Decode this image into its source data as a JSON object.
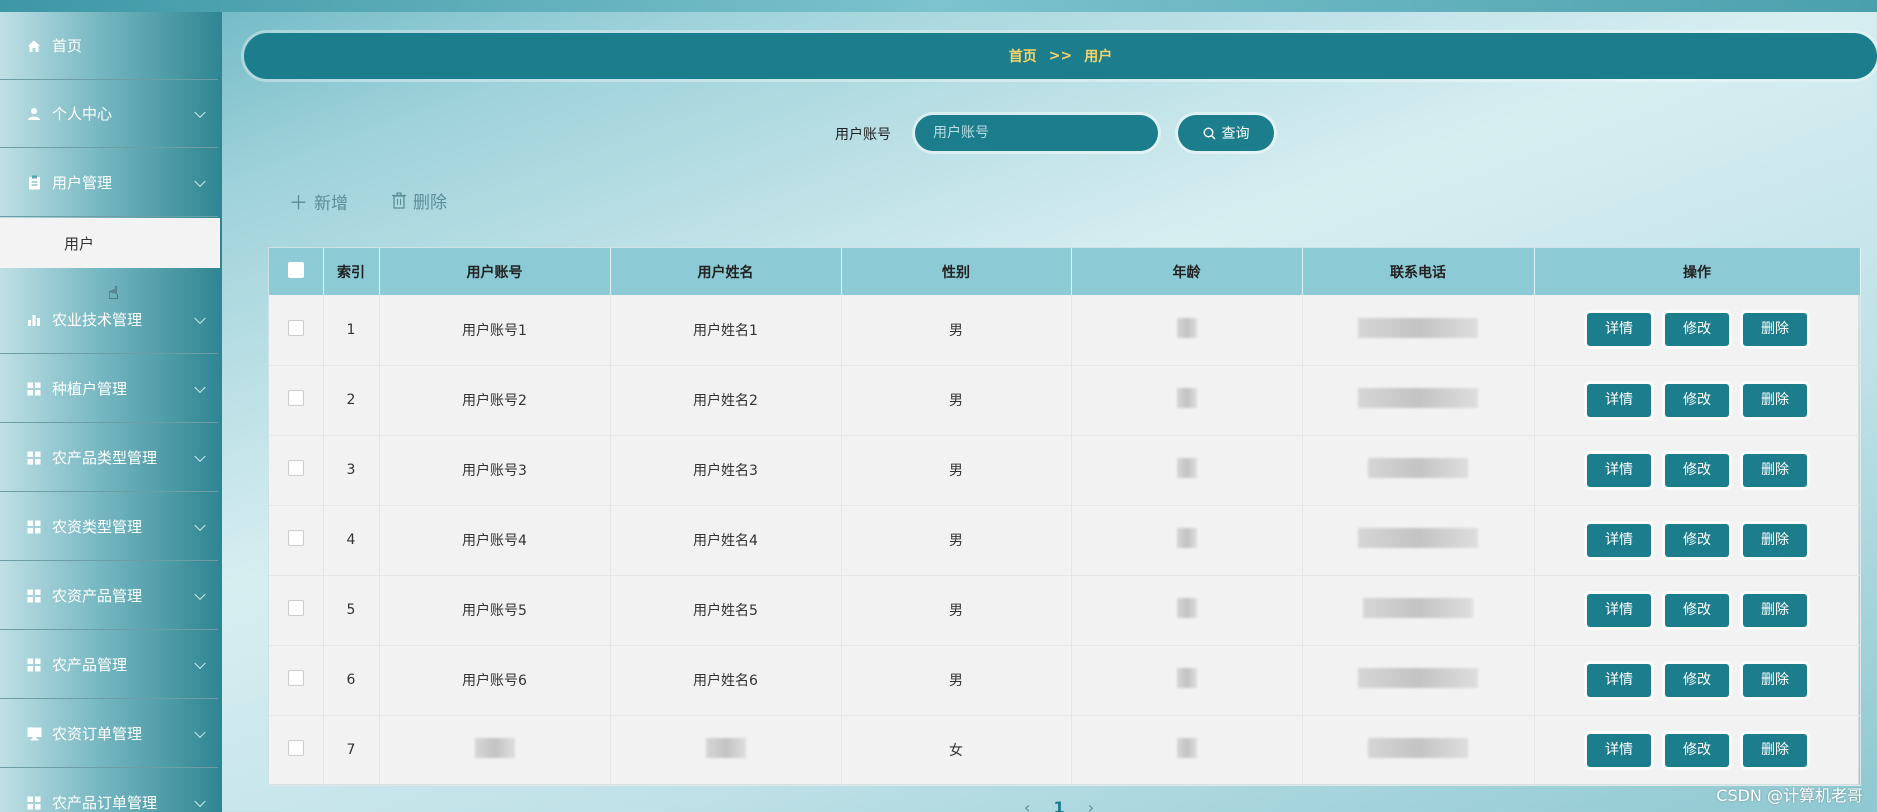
{
  "sidebar": {
    "items": [
      {
        "label": "首页",
        "icon": "home-icon",
        "has_arrow": false
      },
      {
        "label": "个人中心",
        "icon": "user-icon",
        "has_arrow": true
      },
      {
        "label": "用户管理",
        "icon": "clipboard-icon",
        "has_arrow": true
      },
      {
        "label": "农业技术管理",
        "icon": "bar-chart-icon",
        "has_arrow": true
      },
      {
        "label": "种植户管理",
        "icon": "grid-icon",
        "has_arrow": true
      },
      {
        "label": "农产品类型管理",
        "icon": "grid-icon",
        "has_arrow": true
      },
      {
        "label": "农资类型管理",
        "icon": "grid-icon",
        "has_arrow": true
      },
      {
        "label": "农资产品管理",
        "icon": "grid-icon",
        "has_arrow": true
      },
      {
        "label": "农产品管理",
        "icon": "grid-icon",
        "has_arrow": true
      },
      {
        "label": "农资订单管理",
        "icon": "monitor-icon",
        "has_arrow": true
      },
      {
        "label": "农产品订单管理",
        "icon": "grid-icon",
        "has_arrow": true
      }
    ],
    "sub_item": "用户"
  },
  "breadcrumb": {
    "home": "首页",
    "separator": ">>",
    "current": "用户"
  },
  "search": {
    "label": "用户账号",
    "placeholder": "用户账号",
    "button": "查询"
  },
  "actions": {
    "add": "新增",
    "delete": "删除"
  },
  "table": {
    "headers": [
      "索引",
      "用户账号",
      "用户姓名",
      "性别",
      "年龄",
      "联系电话",
      "操作"
    ],
    "rows": [
      {
        "index": "1",
        "account": "用户账号1",
        "name": "用户姓名1",
        "gender": "男"
      },
      {
        "index": "2",
        "account": "用户账号2",
        "name": "用户姓名2",
        "gender": "男"
      },
      {
        "index": "3",
        "account": "用户账号3",
        "name": "用户姓名3",
        "gender": "男"
      },
      {
        "index": "4",
        "account": "用户账号4",
        "name": "用户姓名4",
        "gender": "男"
      },
      {
        "index": "5",
        "account": "用户账号5",
        "name": "用户姓名5",
        "gender": "男"
      },
      {
        "index": "6",
        "account": "用户账号6",
        "name": "用户姓名6",
        "gender": "男"
      },
      {
        "index": "7",
        "account": "",
        "name": "",
        "gender": "女"
      }
    ],
    "row_buttons": {
      "detail": "详情",
      "edit": "修改",
      "delete": "删除"
    }
  },
  "pager": {
    "current": "1"
  },
  "watermark": "CSDN @计算机老哥",
  "colors": {
    "primary": "#1c7d8c",
    "header": "#8ccad5",
    "breadcrumb_text": "#f5d36a"
  }
}
